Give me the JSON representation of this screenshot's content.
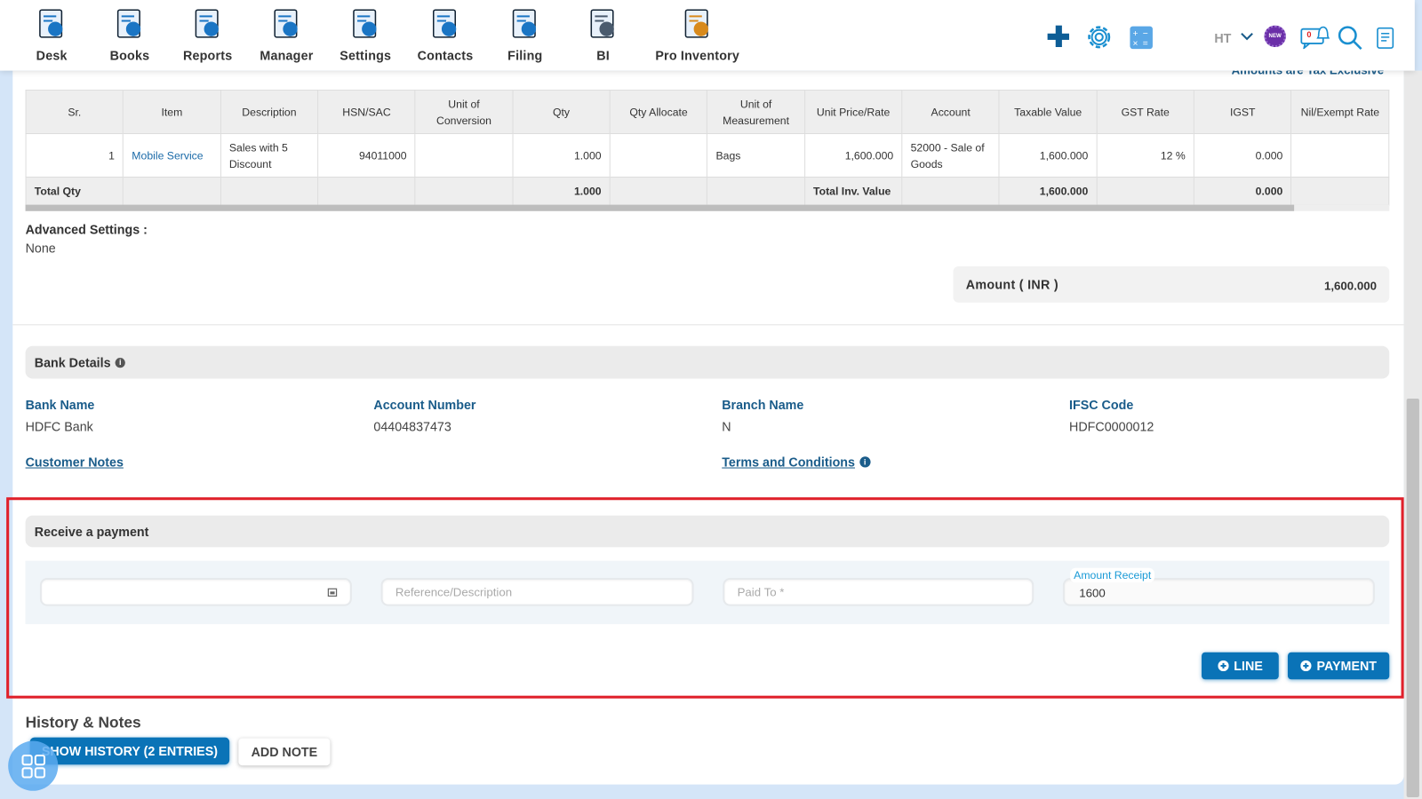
{
  "nav": [
    {
      "label": "Desk",
      "icon": "desk-icon"
    },
    {
      "label": "Books",
      "icon": "books-icon"
    },
    {
      "label": "Reports",
      "icon": "reports-icon"
    },
    {
      "label": "Manager",
      "icon": "manager-icon"
    },
    {
      "label": "Settings",
      "icon": "settings-icon"
    },
    {
      "label": "Contacts",
      "icon": "contacts-icon"
    },
    {
      "label": "Filing",
      "icon": "filing-icon"
    },
    {
      "label": "BI",
      "icon": "bi-robot-icon"
    },
    {
      "label": "Pro Inventory",
      "icon": "pro-inventory-icon"
    }
  ],
  "header_right": {
    "user_initials": "HT",
    "new_badge": "NEW",
    "notification_count": "0"
  },
  "tax_note": "Amounts are Tax Exclusive",
  "table": {
    "columns": [
      "Sr.",
      "Item",
      "Description",
      "HSN/SAC",
      "Unit of Conversion",
      "Qty",
      "Qty Allocate",
      "Unit of Measurement",
      "Unit Price/Rate",
      "Account",
      "Taxable Value",
      "GST Rate",
      "IGST",
      "Nil/Exempt Rate"
    ],
    "rows": [
      [
        "1",
        "Mobile Service",
        "Sales with 5 Discount",
        "94011000",
        "",
        "1.000",
        "",
        "Bags",
        "1,600.000",
        "52000 - Sale of Goods",
        "1,600.000",
        "12 %",
        "0.000",
        ""
      ]
    ],
    "totals": [
      "Total Qty",
      "",
      "",
      "",
      "",
      "1.000",
      "",
      "",
      "Total Inv. Value",
      "",
      "1,600.000",
      "",
      "0.000",
      ""
    ]
  },
  "advanced": {
    "label": "Advanced Settings :",
    "value": "None"
  },
  "amount": {
    "label": "Amount ( INR )",
    "value": "1,600.000"
  },
  "bank": {
    "title": "Bank Details",
    "fields": [
      {
        "label": "Bank Name",
        "value": "HDFC Bank"
      },
      {
        "label": "Account Number",
        "value": "04404837473"
      },
      {
        "label": "Branch Name",
        "value": "N"
      },
      {
        "label": "IFSC Code",
        "value": "HDFC0000012"
      }
    ],
    "customer_notes": "Customer Notes",
    "terms": "Terms and Conditions"
  },
  "payment": {
    "title": "Receive a payment",
    "date_value": "",
    "reference_placeholder": "Reference/Description",
    "paid_to_placeholder": "Paid To *",
    "amount_label": "Amount Receipt",
    "amount_value": "1600",
    "line_button": "LINE",
    "payment_button": "PAYMENT",
    "highlight_color": "#e0202a"
  },
  "history": {
    "title": "History & Notes",
    "show_history": "SHOW HISTORY (2 ENTRIES)",
    "add_note": "ADD NOTE"
  },
  "colors": {
    "primary": "#0a73b7",
    "label_blue": "#1a5c8a",
    "background": "#d4e5f8"
  }
}
